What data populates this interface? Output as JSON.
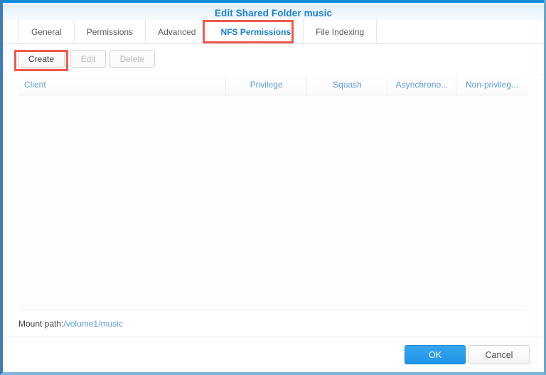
{
  "dialog": {
    "title": "Edit Shared Folder music"
  },
  "tabs": [
    {
      "label": "General",
      "active": false
    },
    {
      "label": "Permissions",
      "active": false
    },
    {
      "label": "Advanced",
      "active": false
    },
    {
      "label": "NFS Permissions",
      "active": true
    },
    {
      "label": "File Indexing",
      "active": false
    }
  ],
  "toolbar": {
    "create_label": "Create",
    "edit_label": "Edit",
    "delete_label": "Delete"
  },
  "table": {
    "columns": [
      {
        "label": "Client"
      },
      {
        "label": "Privilege"
      },
      {
        "label": "Squash"
      },
      {
        "label": "Asynchrono..."
      },
      {
        "label": "Non-privileg..."
      }
    ],
    "rows": []
  },
  "mount": {
    "label": "Mount path:",
    "value": "/volume1/music"
  },
  "footer": {
    "ok_label": "OK",
    "cancel_label": "Cancel"
  },
  "colors": {
    "title_blue": "#1a7fd4",
    "header_accent": "#0d8ed8",
    "annotation_red": "#ef5a4c",
    "link_blue": "#5b9bd5",
    "primary_button": "#1f95e8",
    "window_border": "#3d7cb5"
  }
}
